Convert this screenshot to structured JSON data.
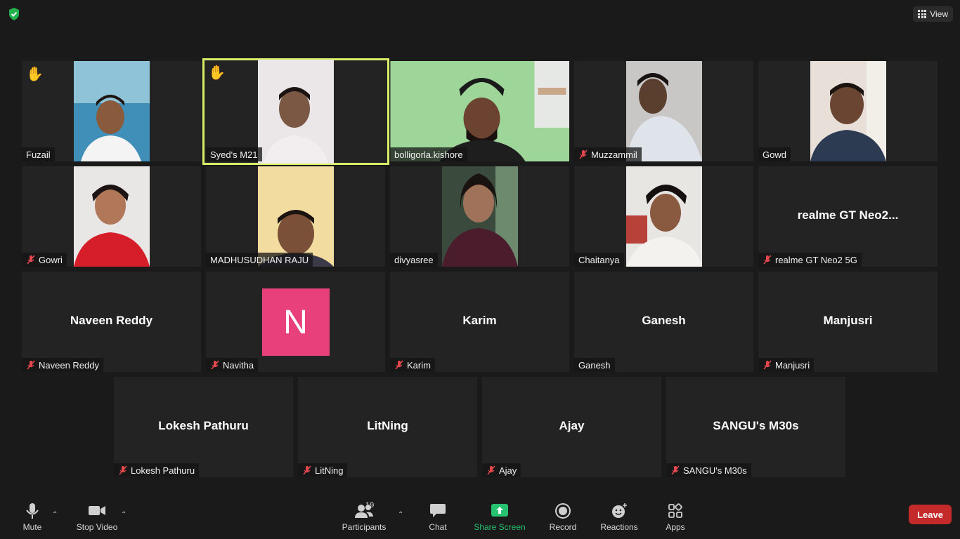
{
  "top": {
    "view_label": "View"
  },
  "participants": {
    "fuzail": "Fuzail",
    "syed": "Syed's M21",
    "kishore": "bolligorla.kishore",
    "muzzammil": "Muzzammil",
    "gowd": "Gowd",
    "gowri": "Gowri",
    "madhu": "MADHUSUDHAN RAJU",
    "divyasree": "divyasree",
    "chaitanya": "Chaitanya",
    "realme_big": "realme GT Neo2...",
    "realme": "realme GT Neo2 5G",
    "naveen": "Naveen Reddy",
    "navitha": "Navitha",
    "navitha_initial": "N",
    "karim": "Karim",
    "ganesh": "Ganesh",
    "manjusri": "Manjusri",
    "lokesh": "Lokesh Pathuru",
    "litning": "LitNing",
    "ajay": "Ajay",
    "sangu": "SANGU's M30s"
  },
  "toolbar": {
    "mute": "Mute",
    "stop_video": "Stop Video",
    "participants": "Participants",
    "participant_count": "19",
    "chat": "Chat",
    "share_screen": "Share Screen",
    "record": "Record",
    "reactions": "Reactions",
    "apps": "Apps",
    "leave": "Leave"
  },
  "colors": {
    "active_speaker": "#d9ef6a",
    "share_green": "#26c26f",
    "leave_red": "#c52a2a",
    "avatar_pink": "#e8407a",
    "muted_red": "#e5484d"
  },
  "icons": {
    "hand_raised": "✋"
  }
}
